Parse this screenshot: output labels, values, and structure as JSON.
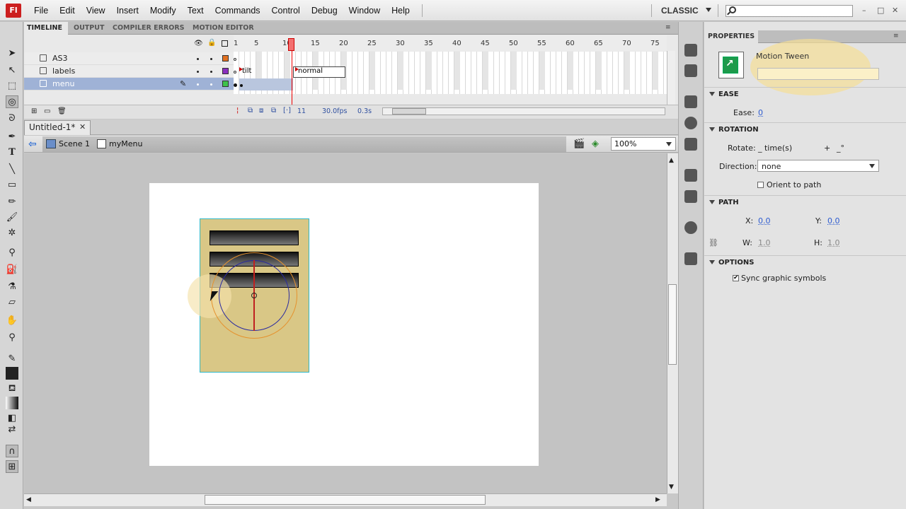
{
  "app": {
    "logo_text": "Fl",
    "menu": [
      "File",
      "Edit",
      "View",
      "Insert",
      "Modify",
      "Text",
      "Commands",
      "Control",
      "Debug",
      "Window",
      "Help"
    ],
    "workspace": "CLASSIC",
    "window_controls": {
      "minimize": "–",
      "maximize": "□",
      "close": "✕"
    }
  },
  "timeline": {
    "tabs": [
      "TIMELINE",
      "OUTPUT",
      "COMPILER ERRORS",
      "MOTION EDITOR"
    ],
    "frame_numbers": [
      "5",
      "10",
      "15",
      "20",
      "25",
      "30",
      "35",
      "40",
      "45",
      "50",
      "55",
      "60",
      "65",
      "70",
      "75"
    ],
    "current_frame_marker": "1",
    "layers": [
      {
        "name": "AS3",
        "color": "#e07020",
        "selected": false
      },
      {
        "name": "labels",
        "color": "#8a2fbf",
        "selected": false
      },
      {
        "name": "menu",
        "color": "#3ec24a",
        "selected": true
      }
    ],
    "frame_labels": {
      "tilt": "tilt",
      "normal": "normal"
    },
    "footer": {
      "current_frame": "11",
      "fps": "30.0fps",
      "elapsed": "0.3s"
    }
  },
  "document": {
    "tab_label": "Untitled-1*",
    "close_label": "✕",
    "scene": "Scene 1",
    "symbol": "myMenu",
    "zoom": "100%"
  },
  "properties": {
    "tab": "PROPERTIES",
    "type": "Motion Tween",
    "instance_name": "",
    "sections": {
      "ease": "EASE",
      "rotation": "ROTATION",
      "path": "PATH",
      "options": "OPTIONS"
    },
    "ease": {
      "label": "Ease:",
      "value": "0"
    },
    "rotation": {
      "label": "Rotate:",
      "times": "_ time(s)",
      "plus": "+",
      "degrees": "_°",
      "direction_label": "Direction:",
      "direction_value": "none",
      "orient_label": "Orient to path",
      "orient_checked": false
    },
    "path": {
      "x_label": "X:",
      "x": "0.0",
      "y_label": "Y:",
      "y": "0.0",
      "w_label": "W:",
      "w": "1.0",
      "h_label": "H:",
      "h": "1.0"
    },
    "options": {
      "sync_label": "Sync graphic symbols",
      "sync_checked": true
    }
  }
}
